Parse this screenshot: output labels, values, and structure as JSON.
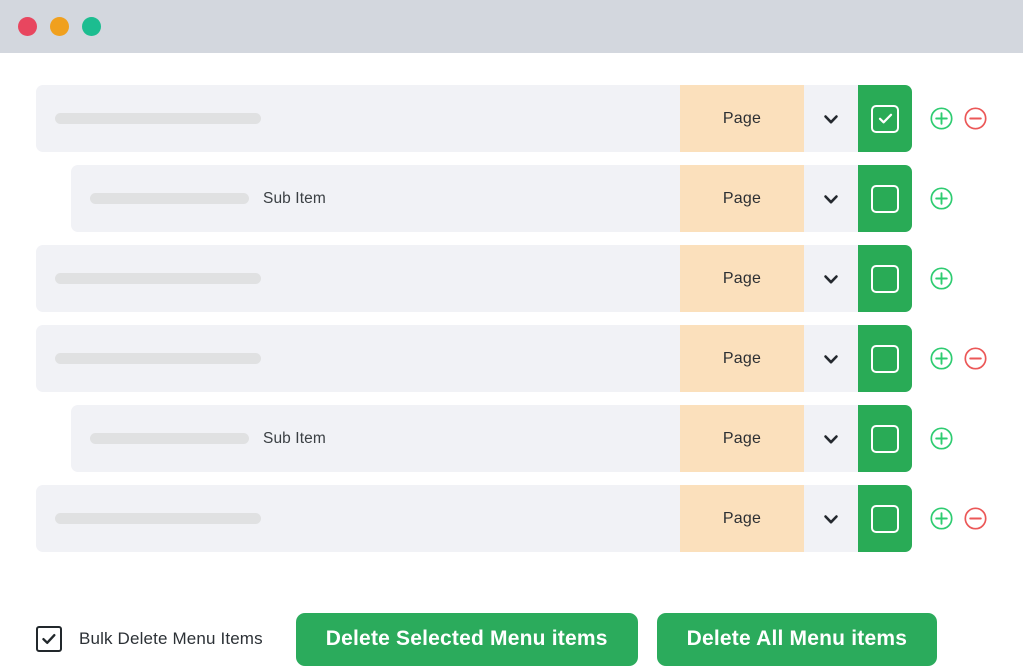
{
  "window": {
    "dots": [
      {
        "name": "close-dot",
        "color": "#e8465f"
      },
      {
        "name": "minimize-dot",
        "color": "#f0a01e"
      },
      {
        "name": "maximize-dot",
        "color": "#1cbd90"
      }
    ]
  },
  "theme": {
    "page_background": "#ffffff",
    "titlebar": "#d3d7de",
    "row_background": "#f1f2f6",
    "placeholder_bar": "#e0e1e2",
    "page_chip": "#fbe0bc",
    "green_accent": "#29ab56",
    "button_green": "#2bab5c",
    "plus_green": "#2ecc71",
    "minus_red": "#eb5757",
    "text_dark": "#2c3136"
  },
  "menu": {
    "type_label": "Page",
    "sub_item_label": "Sub Item",
    "rows": [
      {
        "level": 0,
        "label": "",
        "type": "Page",
        "checked": true,
        "has_add": true,
        "has_remove": true
      },
      {
        "level": 1,
        "label": "Sub Item",
        "type": "Page",
        "checked": false,
        "has_add": true,
        "has_remove": false
      },
      {
        "level": 0,
        "label": "",
        "type": "Page",
        "checked": false,
        "has_add": true,
        "has_remove": false
      },
      {
        "level": 0,
        "label": "",
        "type": "Page",
        "checked": false,
        "has_add": true,
        "has_remove": true
      },
      {
        "level": 1,
        "label": "Sub Item",
        "type": "Page",
        "checked": false,
        "has_add": true,
        "has_remove": false
      },
      {
        "level": 0,
        "label": "",
        "type": "Page",
        "checked": false,
        "has_add": true,
        "has_remove": true
      }
    ]
  },
  "footer": {
    "bulk_delete_checked": true,
    "bulk_delete_label": "Bulk Delete Menu Items",
    "delete_selected_label": "Delete Selected Menu items",
    "delete_all_label": "Delete All Menu items"
  }
}
